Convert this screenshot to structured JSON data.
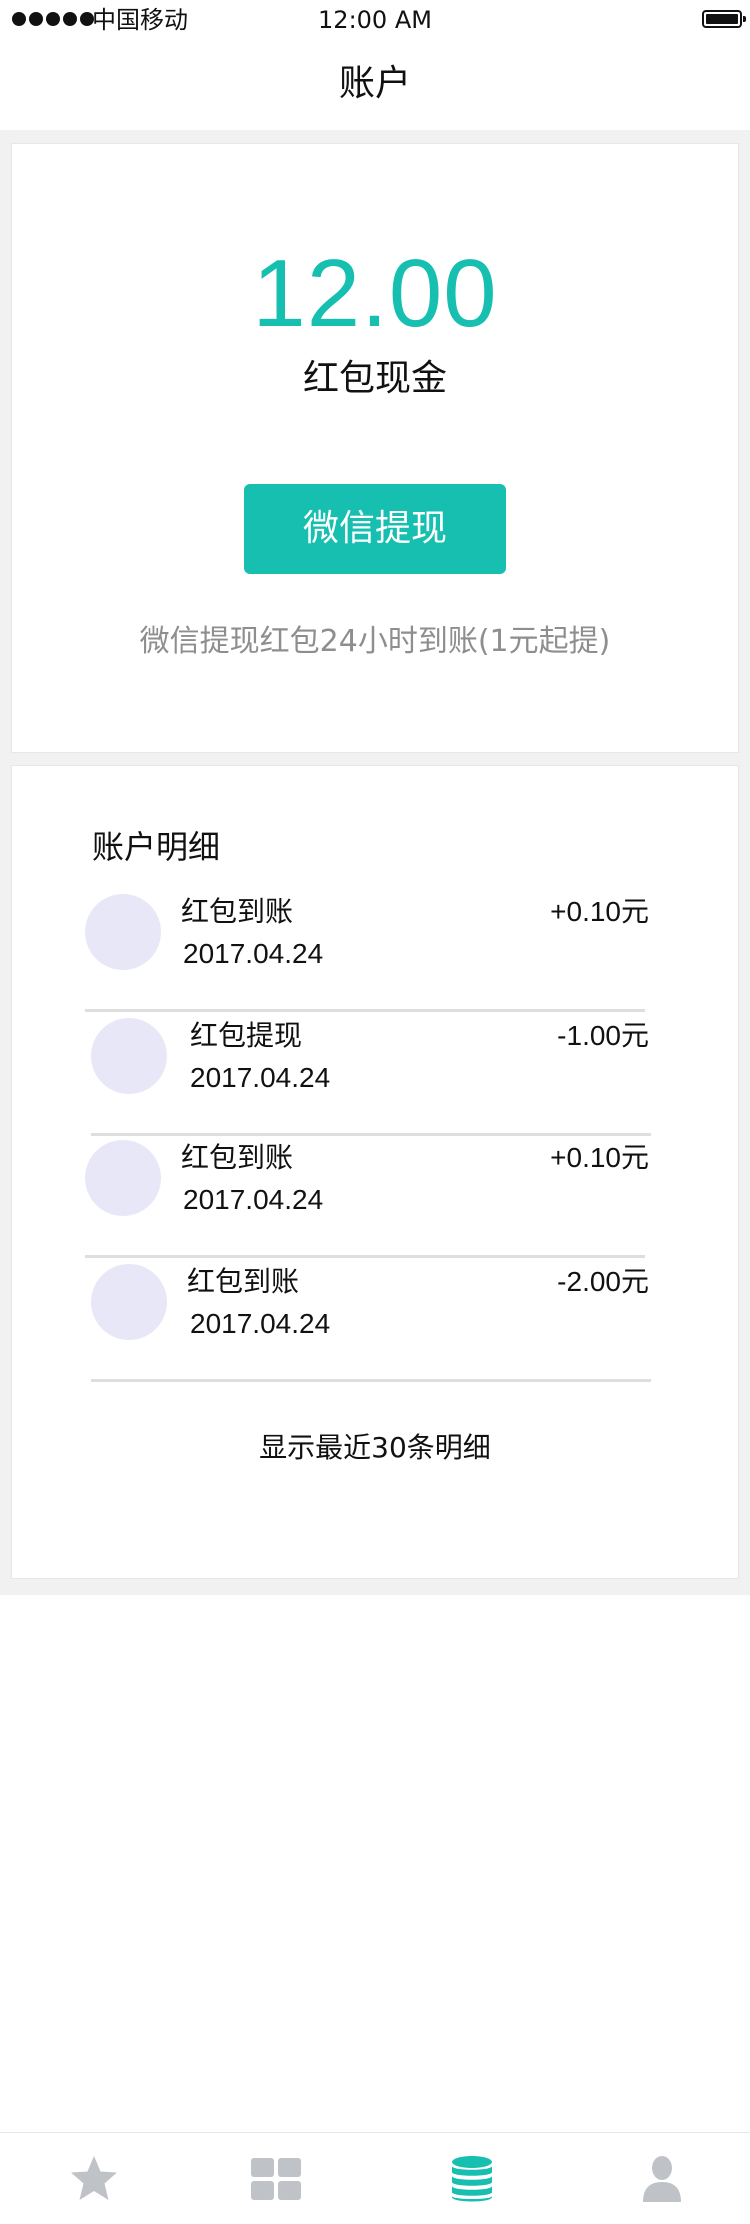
{
  "status_bar": {
    "carrier": "中国移动",
    "time": "12:00 AM"
  },
  "nav": {
    "title": "账户"
  },
  "balance": {
    "amount": "12.00",
    "label": "红包现金",
    "withdraw_button": "微信提现",
    "note": "微信提现红包24小时到账(1元起提)"
  },
  "details": {
    "title": "账户明细",
    "items": [
      {
        "title": "红包到账",
        "date": "2017.04.24",
        "amount": "+0.10元"
      },
      {
        "title": "红包提现",
        "date": "2017.04.24",
        "amount": "-1.00元"
      },
      {
        "title": "红包到账",
        "date": "2017.04.24",
        "amount": "+0.10元"
      },
      {
        "title": "红包到账",
        "date": "2017.04.24",
        "amount": "-2.00元"
      }
    ],
    "footer": "显示最近30条明细"
  },
  "tab_bar": {
    "tabs": [
      {
        "icon": "star-icon",
        "active": false
      },
      {
        "icon": "grid-icon",
        "active": false
      },
      {
        "icon": "coins-stack-icon",
        "active": true
      },
      {
        "icon": "person-icon",
        "active": false
      }
    ]
  },
  "colors": {
    "accent": "#16bfb0",
    "avatar_placeholder": "#e8e7f8",
    "inactive_icon": "#bfc3c8",
    "background": "#f1f1f1"
  }
}
